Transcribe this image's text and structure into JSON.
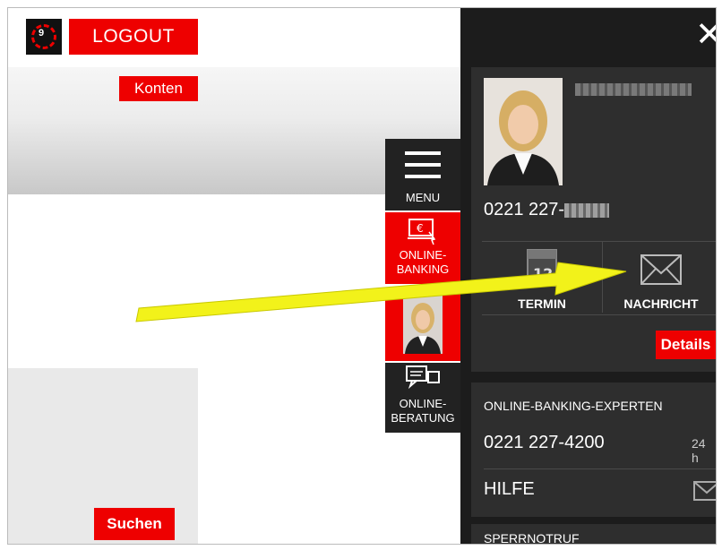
{
  "header": {
    "logo_badge": "9",
    "logout_label": "LOGOUT"
  },
  "left_page": {
    "konten_label": "Konten",
    "suchen_label": "Suchen"
  },
  "side_tabs": {
    "menu_label": "MENU",
    "online_banking_line1": "ONLINE-",
    "online_banking_line2": "BANKING",
    "online_beratung_line1": "ONLINE-",
    "online_beratung_line2": "BERATUNG"
  },
  "advisor_panel": {
    "close_icon": "close-icon",
    "phone_prefix": "0221 227-",
    "termin_day": "12",
    "termin_label": "TERMIN",
    "nachricht_label": "NACHRICHT",
    "details_label": "Details"
  },
  "experts": {
    "title": "ONLINE-BANKING-EXPERTEN",
    "phone": "0221 227-4200",
    "hours": "24 h",
    "hilfe_label": "HILFE"
  },
  "sperrnotruf": {
    "title": "SPERRNOTRUF"
  },
  "colors": {
    "accent": "#ee0000",
    "panel_bg": "#1c1c1c",
    "card_bg": "#2e2e2e",
    "arrow": "#f2f21a"
  }
}
